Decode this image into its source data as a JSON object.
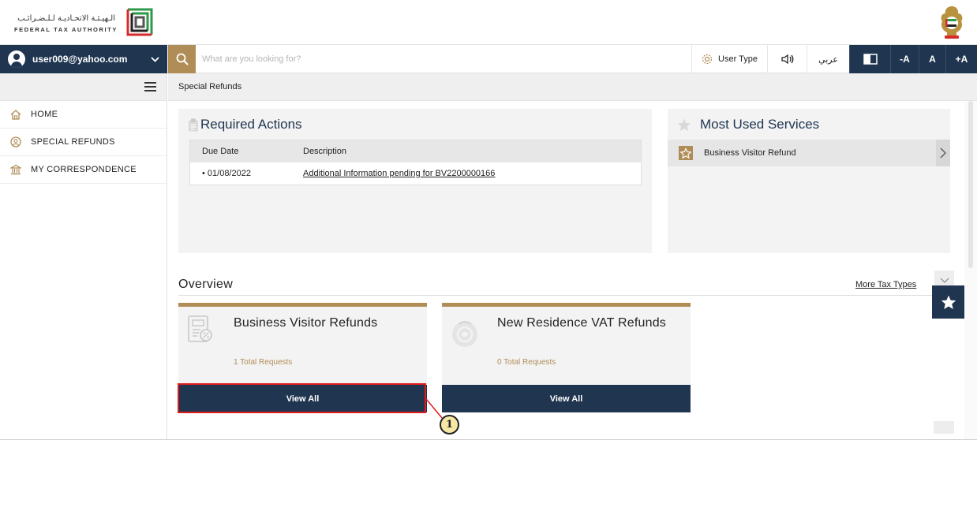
{
  "header": {
    "logo_ar": "الـهيـئـة الاتحـاديـة لـلـضـرائـب",
    "logo_en": "FEDERAL TAX AUTHORITY",
    "emblem_icon": "uae-emblem-icon"
  },
  "toolbar": {
    "user_email": "user009@yahoo.com",
    "search_placeholder": "What are you looking for?",
    "user_type_label": "User Type",
    "language_label": "عربي",
    "font_decrease": "-A",
    "font_default": "A",
    "font_increase": "+A"
  },
  "sidebar": {
    "items": [
      {
        "label": "HOME",
        "icon": "home-icon"
      },
      {
        "label": "SPECIAL REFUNDS",
        "icon": "refund-icon"
      },
      {
        "label": "MY CORRESPONDENCE",
        "icon": "bank-icon"
      }
    ]
  },
  "breadcrumb": {
    "current": "Special Refunds"
  },
  "required_actions": {
    "title": "Required Actions",
    "columns": [
      "Due Date",
      "Description"
    ],
    "rows": [
      {
        "due_date": "• 01/08/2022",
        "description": "Additional Information pending for BV2200000166"
      }
    ]
  },
  "most_used": {
    "title": "Most Used Services",
    "items": [
      {
        "label": "Business Visitor Refund"
      }
    ]
  },
  "overview": {
    "title": "Overview",
    "more_link": "More Tax Types",
    "cards": [
      {
        "title": "Business Visitor Refunds",
        "count": "1 Total Requests",
        "button": "View All"
      },
      {
        "title": "New Residence VAT Refunds",
        "count": "0 Total Requests",
        "button": "View All"
      }
    ]
  },
  "annotation": {
    "callout_number": "1"
  },
  "colors": {
    "navy": "#1f3550",
    "gold": "#b08d57",
    "highlight": "#e01b1b"
  }
}
